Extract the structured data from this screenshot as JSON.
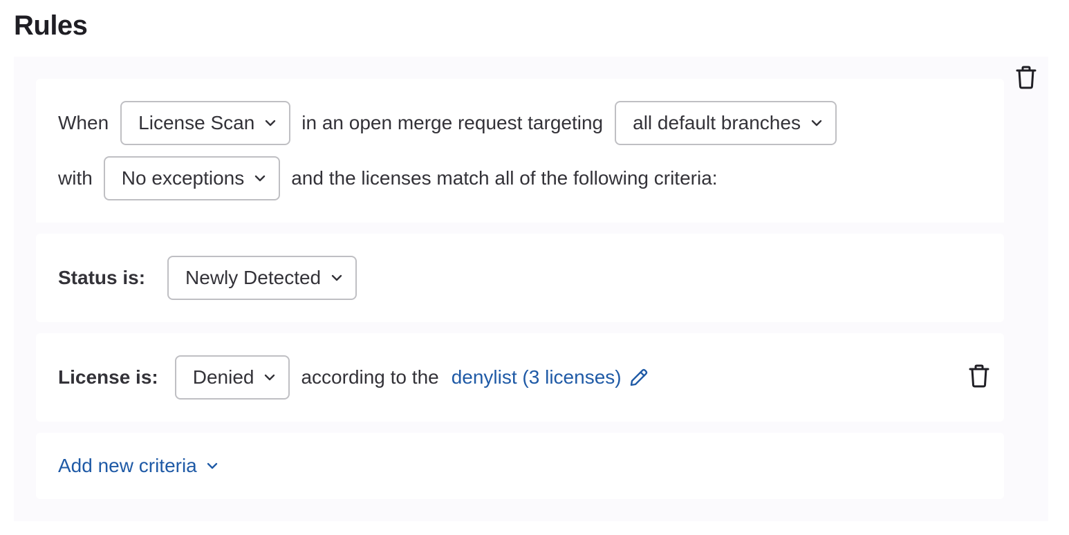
{
  "page": {
    "title": "Rules"
  },
  "rule": {
    "when_label": "When",
    "scanner": {
      "selected": "License Scan"
    },
    "targeting_text": "in an open merge request targeting",
    "branches": {
      "selected": "all default branches"
    },
    "with_label": "with",
    "exceptions": {
      "selected": "No exceptions"
    },
    "criteria_text": "and the licenses match all of the following criteria:",
    "delete_icon": "trash-icon"
  },
  "status_criteria": {
    "label": "Status is:",
    "selected": "Newly Detected"
  },
  "license_criteria": {
    "label": "License is:",
    "selected": "Denied",
    "according_text": "according to the",
    "list_link": "denylist (3 licenses)",
    "edit_icon": "pencil-icon",
    "delete_icon": "trash-icon"
  },
  "add_criteria": {
    "label": "Add new criteria"
  },
  "colors": {
    "link": "#1f5aa6",
    "panel_bg": "#fbfafd",
    "border": "#bfbfc3",
    "text": "#333238"
  }
}
